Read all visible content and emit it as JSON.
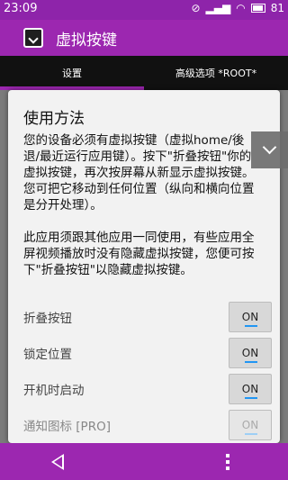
{
  "status_bar": {
    "time": "23:09",
    "battery": "81",
    "icons": [
      "mute-icon",
      "signal-icon",
      "wifi-icon",
      "battery-icon"
    ]
  },
  "app_bar": {
    "title": "虚拟按键",
    "icon": "app-collapse-icon"
  },
  "tabs": [
    {
      "label": "设置",
      "active": true
    },
    {
      "label": "高级选项 *ROOT*",
      "active": false
    }
  ],
  "dialog": {
    "title": "使用方法",
    "paragraph1": "您的设备必须有虚拟按键（虚拟home/後退/最近运行应用键）。按下\"折叠按钮\"你的虚拟按键，再次按屏幕从新显示虚拟按键。您可把它移动到任何位置（纵向和横向位置是分开处理）。",
    "paragraph2": "此应用须跟其他应用一同使用，有些应用全屏视频播放时没有隐藏虚拟按键，您便可按下\"折叠按钮\"以隐藏虚拟按键。"
  },
  "settings": [
    {
      "label": "折叠按钮",
      "value": "ON",
      "enabled": true
    },
    {
      "label": "锁定位置",
      "value": "ON",
      "enabled": true
    },
    {
      "label": "开机时启动",
      "value": "ON",
      "enabled": true
    },
    {
      "label": "通知图标 [PRO]",
      "value": "ON",
      "enabled": false
    }
  ],
  "floating_button": {
    "icon": "chevron-down-icon"
  },
  "nav_bar": {
    "back_icon": "back-icon",
    "menu_icon": "menu-icon"
  },
  "colors": {
    "accent": "#9c27b0",
    "toggle_indicator": "#2196f3"
  }
}
